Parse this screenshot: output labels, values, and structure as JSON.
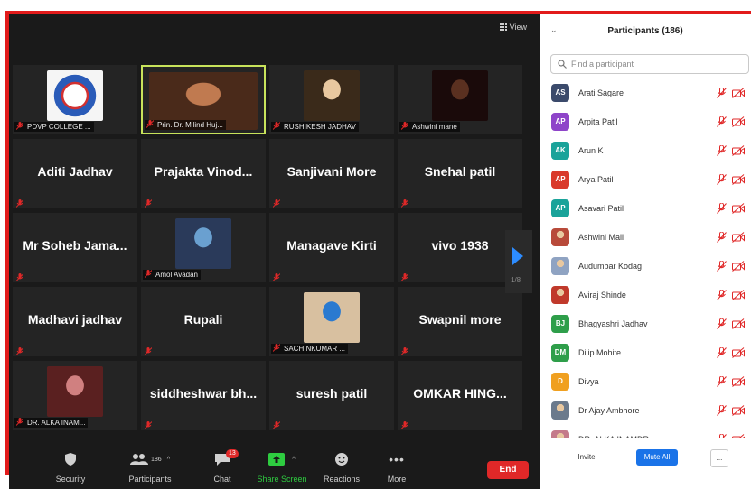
{
  "colors": {
    "active_speaker_border": "#c8e35b",
    "mute_red": "#e02828",
    "accent_blue": "#1a73e8"
  },
  "topbar": {
    "view_label": "View"
  },
  "tiles": [
    {
      "name": "",
      "label": "PDVP COLLEGE ...",
      "type": "logo"
    },
    {
      "name": "",
      "label": "Prin. Dr. Milind Huj...",
      "type": "photo",
      "active": true
    },
    {
      "name": "",
      "label": "RUSHIKESH JADHAV",
      "type": "photo"
    },
    {
      "name": "",
      "label": "Ashwini mane",
      "type": "photo"
    },
    {
      "name": "Aditi Jadhav",
      "label": ""
    },
    {
      "name": "Prajakta  Vinod...",
      "label": ""
    },
    {
      "name": "Sanjivani More",
      "label": ""
    },
    {
      "name": "Snehal patil",
      "label": ""
    },
    {
      "name": "Mr Soheb Jama...",
      "label": ""
    },
    {
      "name": "",
      "label": "Amol Avadan",
      "type": "photo"
    },
    {
      "name": "Managave Kirti",
      "label": ""
    },
    {
      "name": "vivo 1938",
      "label": ""
    },
    {
      "name": "Madhavi jadhav",
      "label": ""
    },
    {
      "name": "Rupali",
      "label": ""
    },
    {
      "name": "",
      "label": "SACHINKUMAR ...",
      "type": "photo"
    },
    {
      "name": "Swapnil more",
      "label": ""
    },
    {
      "name": "",
      "label": "DR. ALKA INAM...",
      "type": "photo"
    },
    {
      "name": "siddheshwar  bh...",
      "label": ""
    },
    {
      "name": "suresh patil",
      "label": ""
    },
    {
      "name": "OMKAR  HING...",
      "label": ""
    }
  ],
  "pager": {
    "indicator": "1/8"
  },
  "toolbar": {
    "security": "Security",
    "participants": "Participants",
    "participants_count": "186",
    "chat": "Chat",
    "chat_badge": "13",
    "share_screen": "Share Screen",
    "reactions": "Reactions",
    "more": "More",
    "end": "End"
  },
  "panel": {
    "title": "Participants (186)",
    "search_placeholder": "Find a participant",
    "participants": [
      {
        "initials": "AS",
        "name": "Arati Sagare",
        "color": "#3b4a6b"
      },
      {
        "initials": "AP",
        "name": "Arpita Patil",
        "color": "#8e44c9"
      },
      {
        "initials": "AK",
        "name": "Arun K",
        "color": "#1aa39a"
      },
      {
        "initials": "AP",
        "name": "Arya Patil",
        "color": "#d93a2b"
      },
      {
        "initials": "AP",
        "name": "Asavari Patil",
        "color": "#1aa39a"
      },
      {
        "initials": "",
        "name": "Ashwini Mali",
        "color": "#b84a3a"
      },
      {
        "initials": "",
        "name": "Audumbar Kodag",
        "color": "#8fa3c2"
      },
      {
        "initials": "",
        "name": "Aviraj Shinde",
        "color": "#c0392b"
      },
      {
        "initials": "BJ",
        "name": "Bhagyashri Jadhav",
        "color": "#2e9e4a"
      },
      {
        "initials": "DM",
        "name": "Dilip Mohite",
        "color": "#2e9e4a"
      },
      {
        "initials": "D",
        "name": "Divya",
        "color": "#f0a020"
      },
      {
        "initials": "",
        "name": "Dr Ajay Ambhore",
        "color": "#6b7a8c"
      },
      {
        "initials": "",
        "name": "DR. ALKA INAMDR",
        "color": "#c47a8a"
      }
    ],
    "invite": "Invite",
    "mute_all": "Mute All",
    "more": "..."
  }
}
